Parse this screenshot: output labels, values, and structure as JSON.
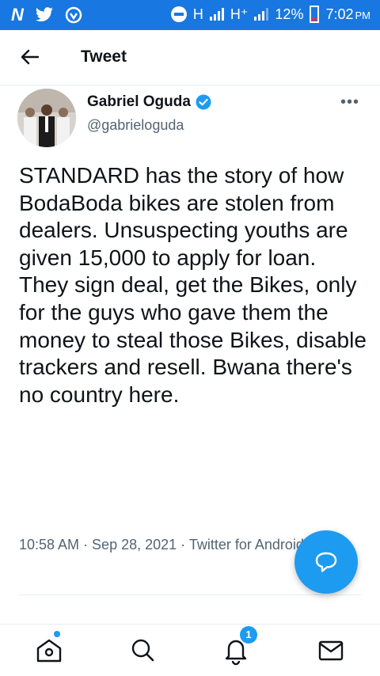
{
  "status_bar": {
    "network_label": "H",
    "network_label_2": "H⁺",
    "battery_percent": "12%",
    "time": "7:02",
    "time_suffix": "PM",
    "left_icons": [
      "n-logo-icon",
      "twitter-bird-icon",
      "vpn-shield-icon"
    ]
  },
  "header": {
    "title": "Tweet",
    "back_icon": "arrow-left-icon"
  },
  "tweet": {
    "author_name": "Gabriel Oguda",
    "author_handle": "@gabrieloguda",
    "verified": true,
    "text": "STANDARD has the story of how BodaBoda bikes are stolen from dealers. Unsuspecting youths are given 15,000 to apply for loan. They sign deal, get the Bikes, only for the guys who gave them the money to steal those Bikes, disable trackers and resell. Bwana there's no country here.",
    "meta": "10:58 AM · Sep 28, 2021 · Twitter for Android",
    "more_icon": "more-horizontal-icon"
  },
  "bottom_nav": {
    "items": [
      "home-icon",
      "search-icon",
      "notifications-icon",
      "messages-icon"
    ],
    "notification_count": "1"
  },
  "colors": {
    "status_bar_bg": "#1877e0",
    "accent": "#1d9bf0",
    "text": "#0f1419",
    "secondary_text": "#536471"
  }
}
